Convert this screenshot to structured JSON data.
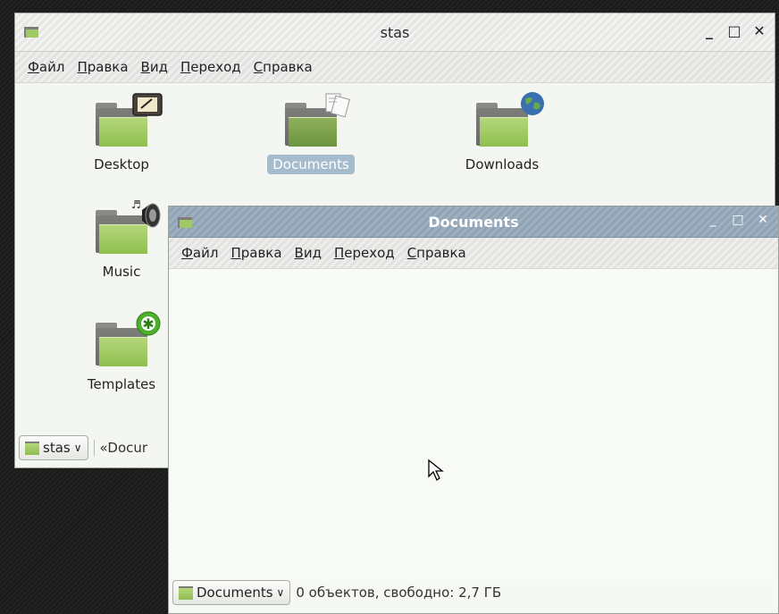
{
  "windows": {
    "back": {
      "title": "stas",
      "menu": [
        "Файл",
        "Правка",
        "Вид",
        "Переход",
        "Справка"
      ],
      "folders": [
        {
          "label": "Desktop",
          "emblem": "desktop-emblem"
        },
        {
          "label": "Documents",
          "emblem": "documents-emblem",
          "selected": true
        },
        {
          "label": "Downloads",
          "emblem": "globe-emblem"
        },
        {
          "label": "Music",
          "emblem": "speaker-emblem"
        },
        {
          "label": "Templates",
          "emblem": "star-emblem"
        }
      ],
      "location_combo": "stas",
      "location_crumb": "«Docur"
    },
    "front": {
      "title": "Documents",
      "menu": [
        "Файл",
        "Правка",
        "Вид",
        "Переход",
        "Справка"
      ],
      "location_combo": "Documents",
      "status": "0 объектов, свободно: 2,7 ГБ"
    }
  },
  "colors": {
    "folder_green": "#9fc964",
    "selection": "#a6bccc",
    "front_titlebar": "#94a8b8"
  }
}
